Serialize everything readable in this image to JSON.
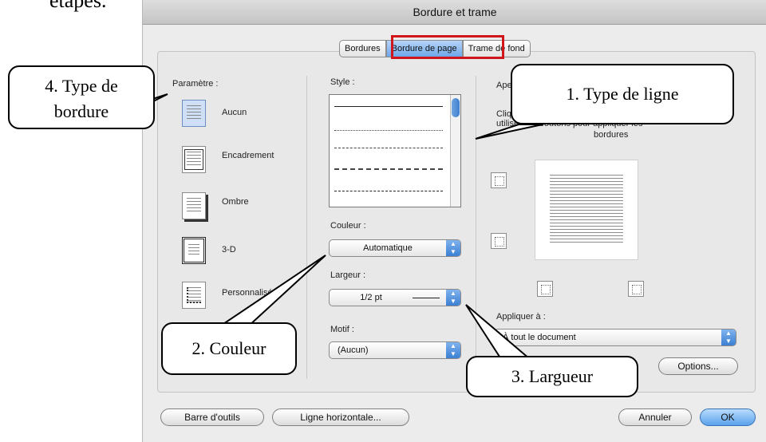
{
  "page_text": "étapes.",
  "dialog": {
    "title": "Bordure et trame",
    "tabs": [
      {
        "label": "Bordures",
        "active": false
      },
      {
        "label": "Bordure de page",
        "active": true
      },
      {
        "label": "Trame de fond",
        "active": false
      }
    ],
    "settings": {
      "heading": "Paramètre :",
      "presets": [
        {
          "label": "Aucun",
          "icon": "border-none-icon",
          "selected": true
        },
        {
          "label": "Encadrement",
          "icon": "border-box-icon",
          "selected": false
        },
        {
          "label": "Ombre",
          "icon": "border-shadow-icon",
          "selected": false
        },
        {
          "label": "3-D",
          "icon": "border-3d-icon",
          "selected": false
        },
        {
          "label": "Personnalisé",
          "icon": "border-custom-icon",
          "selected": false
        }
      ]
    },
    "style": {
      "heading": "Style :",
      "items": [
        "solid",
        "dotted",
        "dashed-small",
        "dashed",
        "dash-dot"
      ]
    },
    "color": {
      "heading": "Couleur :",
      "value": "Automatique"
    },
    "width": {
      "heading": "Largeur :",
      "value": "1/2 pt"
    },
    "art": {
      "heading": "Motif :",
      "value": "(Aucun)"
    },
    "preview": {
      "heading": "Aperçu",
      "hint_1": "Cliquez",
      "hint_2": "utilisez les boutons pour appliquer les",
      "hint_3": "bordures"
    },
    "apply_to": {
      "heading": "Appliquer à :",
      "value": "À tout le document"
    },
    "buttons": {
      "options": "Options...",
      "toolbar": "Barre d'outils",
      "horizontal_line": "Ligne horizontale...",
      "cancel": "Annuler",
      "ok": "OK"
    }
  },
  "callouts": {
    "line_type": "1. Type de ligne",
    "color": "2. Couleur",
    "width": "3. Largueur",
    "border_type_1": "4. Type de",
    "border_type_2": "bordure"
  },
  "colors": {
    "highlight": "#d0161b",
    "accent": "#3c7fd3"
  }
}
